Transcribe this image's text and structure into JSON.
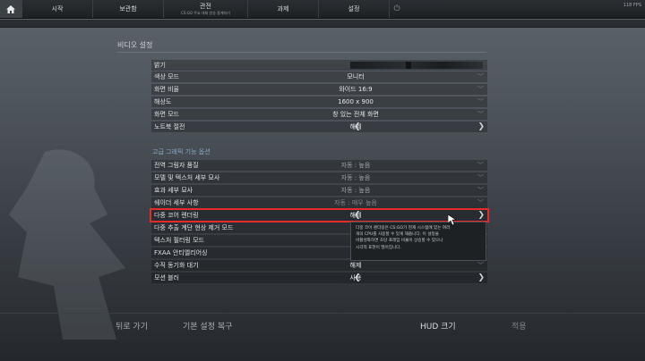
{
  "nav": {
    "tabs": [
      {
        "label": "시작"
      },
      {
        "label": "보관함"
      },
      {
        "label": "관전",
        "sub": "CS:GO 주요 대회 방송 중계하기"
      },
      {
        "label": "과제"
      },
      {
        "label": "설정"
      }
    ],
    "fps": "118 FPS"
  },
  "section_title": "비디오 설정",
  "rows": [
    {
      "label": "밝기"
    },
    {
      "label": "색상 모드",
      "value": "모니터"
    },
    {
      "label": "화면 비율",
      "value": "와이드 16:9"
    },
    {
      "label": "해상도",
      "value": "1600 x 900"
    },
    {
      "label": "화면 모드",
      "value": "창 있는 전체 화면"
    },
    {
      "label": "노트북 절전",
      "value": "해제"
    }
  ],
  "advanced_header": "고급 그래픽 기능 옵션",
  "advanced_rows": [
    {
      "label": "전역 그림자 품질",
      "value": "자동 : 높음"
    },
    {
      "label": "모델 및 텍스처 세부 묘사",
      "value": "자동 : 높음"
    },
    {
      "label": "효과 세부 묘사",
      "value": "자동 : 높음"
    },
    {
      "label": "쉐이더 세부 사항",
      "value": "자동 : 매우 높음"
    },
    {
      "label": "다중 코어 렌더링",
      "value": "해제"
    },
    {
      "label": "다중 추출 계단 현상 제거 모드"
    },
    {
      "label": "텍스처 필터링 모드"
    },
    {
      "label": "FXAA 안티엘리어싱"
    },
    {
      "label": "수직 동기화 대기",
      "value": "해제"
    },
    {
      "label": "모션 블러",
      "value": "사용"
    }
  ],
  "tooltip": {
    "lines": [
      "다중 코어 렌더링은 CS:GO가 현재 시스템에 있는 여러",
      "개의 CPU를 사용할 수 있게 해줍니다. 이 설정을",
      "비활성화하면 초당 프레임 비율이 상승할 수 있으나",
      "시각적 표현이 떨어집니다."
    ]
  },
  "bottom": {
    "back": "뒤로 가기",
    "reset": "기본 설정 복구",
    "hud": "HUD 크기",
    "apply": "적용"
  },
  "colors": {
    "highlight": "#e62b2b",
    "subhead": "#87a8c2"
  }
}
